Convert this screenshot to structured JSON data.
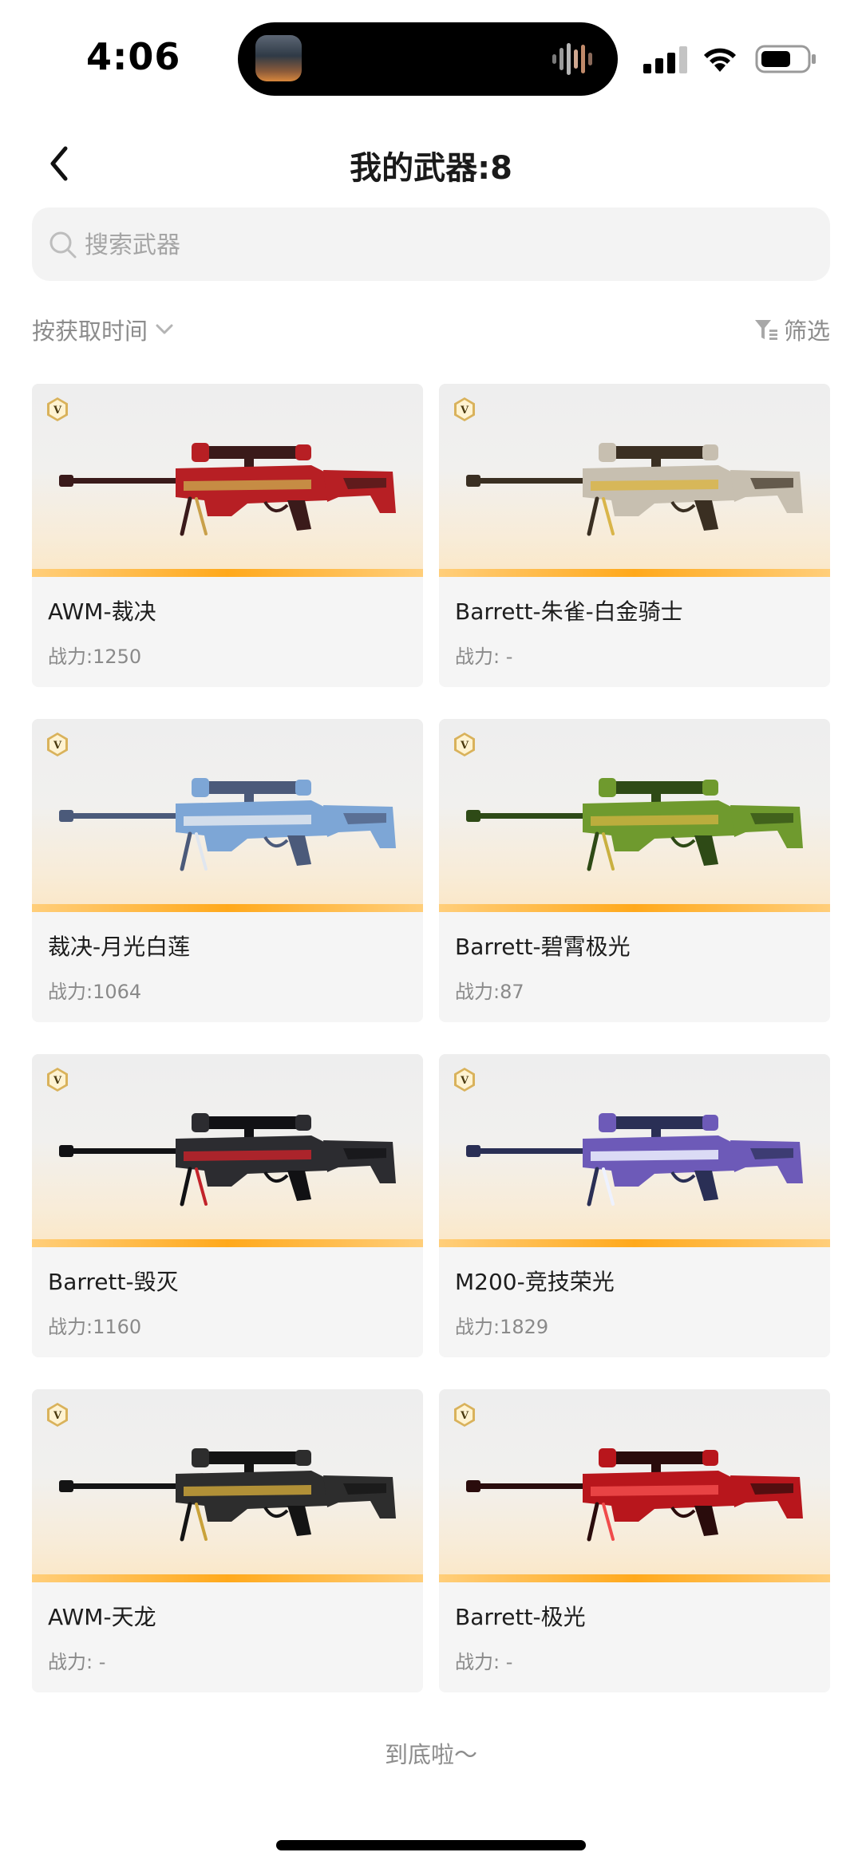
{
  "status_bar": {
    "time": "4:06"
  },
  "header": {
    "title": "我的武器:8"
  },
  "search": {
    "placeholder": "搜索武器"
  },
  "toolbar": {
    "sort_label": "按获取时间",
    "filter_label": "筛选"
  },
  "weapons": [
    {
      "name": "AWM-裁决",
      "power": "战力:1250",
      "colors": [
        "#b71f24",
        "#3a1a1a",
        "#c9a04a"
      ]
    },
    {
      "name": "Barrett-朱雀-白金骑士",
      "power": "战力: -",
      "colors": [
        "#c7bfb0",
        "#3a2f22",
        "#d9b54a"
      ]
    },
    {
      "name": "裁决-月光白莲",
      "power": "战力:1064",
      "colors": [
        "#7da6d6",
        "#4b5a7a",
        "#e0e6ef"
      ]
    },
    {
      "name": "Barrett-碧霄极光",
      "power": "战力:87",
      "colors": [
        "#6f9a2e",
        "#2e4a16",
        "#c9b040"
      ]
    },
    {
      "name": "Barrett-毁灭",
      "power": "战力:1160",
      "colors": [
        "#2c2c30",
        "#111114",
        "#c2232a"
      ]
    },
    {
      "name": "M200-竞技荣光",
      "power": "战力:1829",
      "colors": [
        "#6d5ab8",
        "#2a2f55",
        "#eef2ff"
      ]
    },
    {
      "name": "AWM-天龙",
      "power": "战力: -",
      "colors": [
        "#2d2d2d",
        "#141414",
        "#c9a23a"
      ]
    },
    {
      "name": "Barrett-极光",
      "power": "战力: -",
      "colors": [
        "#b8161c",
        "#2a0c0c",
        "#f04b4b"
      ]
    }
  ],
  "footer": {
    "end_text": "到底啦～"
  }
}
